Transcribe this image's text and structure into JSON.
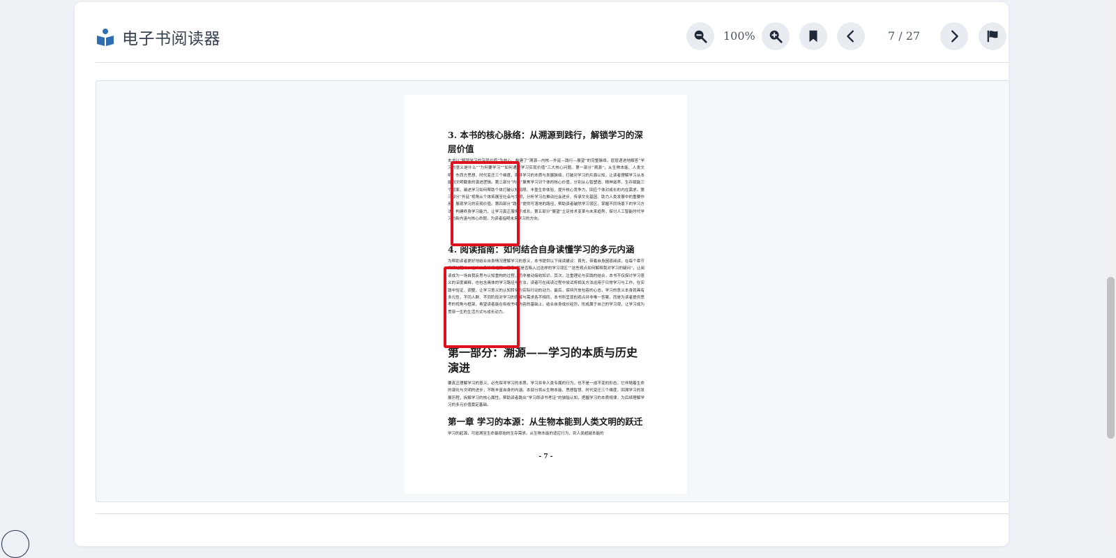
{
  "app": {
    "title": "电子书阅读器",
    "icon": "reader-book-icon",
    "accent_color": "#2f6fb1"
  },
  "toolbar": {
    "zoom_out_icon": "zoom-out-icon",
    "zoom_level": "100%",
    "zoom_in_icon": "zoom-in-icon",
    "bookmark_icon": "bookmark-icon",
    "prev_icon": "chevron-left-icon",
    "page_indicator": "7 / 27",
    "next_icon": "chevron-right-icon",
    "flag_icon": "flag-icon"
  },
  "page": {
    "section3_title": "3. 本书的核心脉络：从溯源到践行，解锁学习的深层价值",
    "section3_text": "本书以“解锁学习的深层价值”为核心，构建了“溯源—内核—外延—践行—展望”的完整脉络，层层递进地解答“学习的意义是什么”“为何要学习”“如何通过学习实现价值”三大核心问题。第一部分“溯源”，从生物本能、人类文明、东西方思想、时代变迁三个维度，探寻学习的本质与发展脉络，打破对学习的片面认知，让读者理解学习从本能到文明载体的演进逻辑。第二部分“内核”聚焦学习对个体的核心价值，分别从心智塑造、精神滋养、生存赋能三个层面，阐述学习如何帮助个体打破认知局限、丰盈生命体验、提升核心竞争力，回应个体对成长的内在需求。第三部分“外延”视角从个体拓展至社会与文明，分析学习在推动社会进步、传承文化基因、助力人类发展中的重要作用，展现学习的宏观价值。第四部分“践行”提供可落地的路径，帮助读者破除学习误区，掌握不同场景下的学习方法，构建终身学习能力，让学习真正服务于成长。第五部分“展望”立足技术变革与未来趋势，探讨人工智能时代学习的新内涵与核心命题，为读者指明未来学习的方向。",
    "section4_title": "4. 阅读指南：如何结合自身读懂学习的多元内涵",
    "section4_text": "为帮助读者更好地结合自身情况理解学习的意义，本书提供以下阅读建议：首先，带着自身困惑阅读，在每个章节阅读过程中，结合自身学习经历，思考“我是否陷入过这样的学习误区”“这些观点如何解释我对学习的疑问”，让阅读成为一场自我反思与认知重构的过程，而非被动接收知识。其次，注重理论与实践的结合，本书不仅探讨学习意义的深度阐释，也包含具体的学习路径与方法，读者可在阅读过程中尝试将相关方法运用于日常学习与工作，在实践中验证、调整，让学习意义的认知转化为实际行动的动力。最后，保持开放包容的心态，学习的意义本身就具有多元性，不同人群、不同阶段对学习的理解与需求各不相同，本书所呈现的观点并非唯一答案，而是为读者提供思考的视角与框架，希望读者能在吸收书中内容的基础上，结合自身成长经历，形成属于自己的学习观，让学习成为贯穿一生的生活方式与成长动力。",
    "part1_title": "第一部分：溯源——学习的本质与历史演进",
    "part1_text": "要真正理解学习的意义，必先探寻学习的本质。学习并非人类专属的行为，也不是一成不变的形态，它伴随着生命的演化与文明的进步，不断丰富自身的内涵。本部分将从生物本能、思想智慧、时代变迁三个维度，回溯学习的发展历程，拆解学习的核心属性，帮助读者跳出“学习即读书考证”的狭隘认知，把握学习的本质规律，为后续理解学习的多元价值奠定基础。",
    "chapter1_title": "第一章 学习的本源：从生物本能到人类文明的跃迁",
    "chapter1_text": "学习的起源，可追溯至生命最原始的生存需求。从生物本能的适应行为，到人类超越本能的",
    "page_number": "- 7 -"
  }
}
